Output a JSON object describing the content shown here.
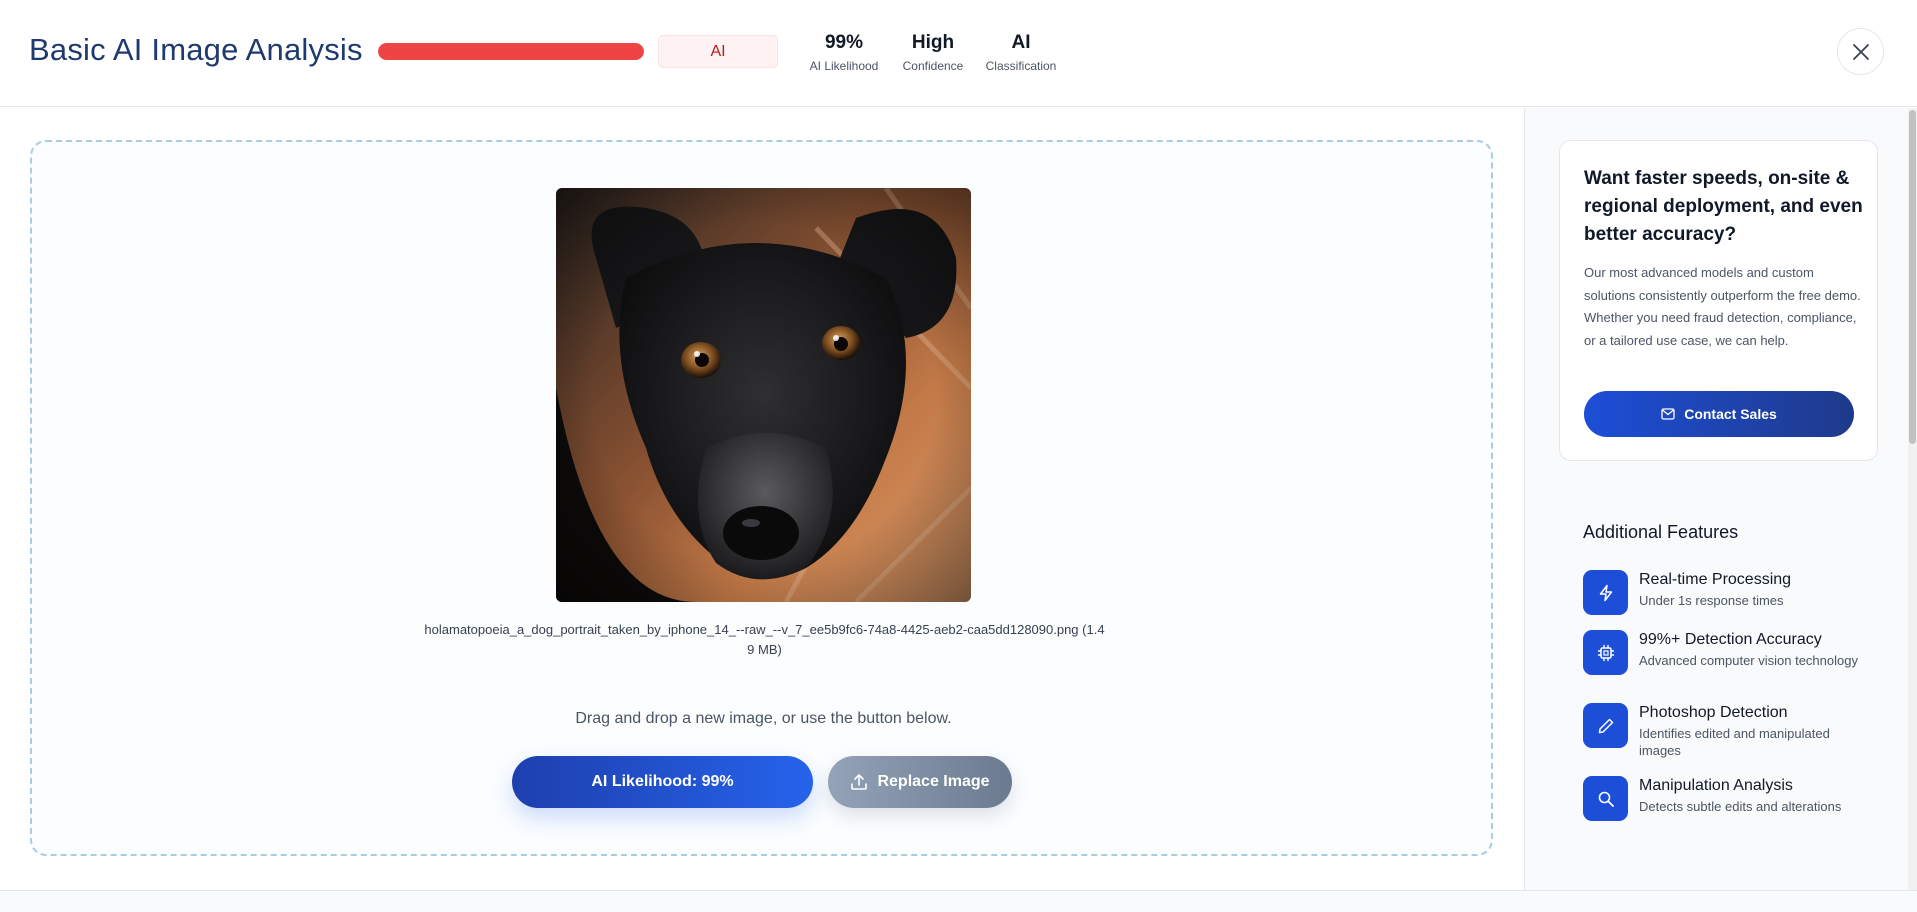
{
  "header": {
    "title": "Basic AI Image Analysis",
    "likelihood_fraction": 1.0,
    "badge": "AI",
    "stats": [
      {
        "value": "99%",
        "label": "AI Likelihood"
      },
      {
        "value": "High",
        "label": "Confidence"
      },
      {
        "value": "AI",
        "label": "Classification"
      }
    ]
  },
  "upload": {
    "file_name": "holamatopoeia_a_dog_portrait_taken_by_iphone_14_--raw_--v_7_ee5b9fc6-74a8-4425-aeb2-caa5dd128090.png (1.49 MB)",
    "drop_hint": "Drag and drop a new image, or use the button below.",
    "likelihood_button": "AI Likelihood: 99%",
    "replace_button": "Replace Image"
  },
  "promo": {
    "title": "Want faster speeds, on-site & regional deployment, and even better accuracy?",
    "body": "Our most advanced models and custom solutions consistently outperform the free demo. Whether you need fraud detection, compliance, or a tailored use case, we can help.",
    "contact_button": "Contact Sales"
  },
  "features": {
    "title": "Additional Features",
    "items": [
      {
        "icon": "bolt-icon",
        "title": "Real-time Processing",
        "desc": "Under 1s response times"
      },
      {
        "icon": "chip-icon",
        "title": "99%+ Detection Accuracy",
        "desc": "Advanced computer vision technology"
      },
      {
        "icon": "pencil-icon",
        "title": "Photoshop Detection",
        "desc": "Identifies edited and manipulated images"
      },
      {
        "icon": "search-icon",
        "title": "Manipulation Analysis",
        "desc": "Detects subtle edits and alterations"
      }
    ]
  },
  "colors": {
    "accent": "#1d4ed8",
    "danger": "#ef4444",
    "title": "#1e3a6e"
  }
}
